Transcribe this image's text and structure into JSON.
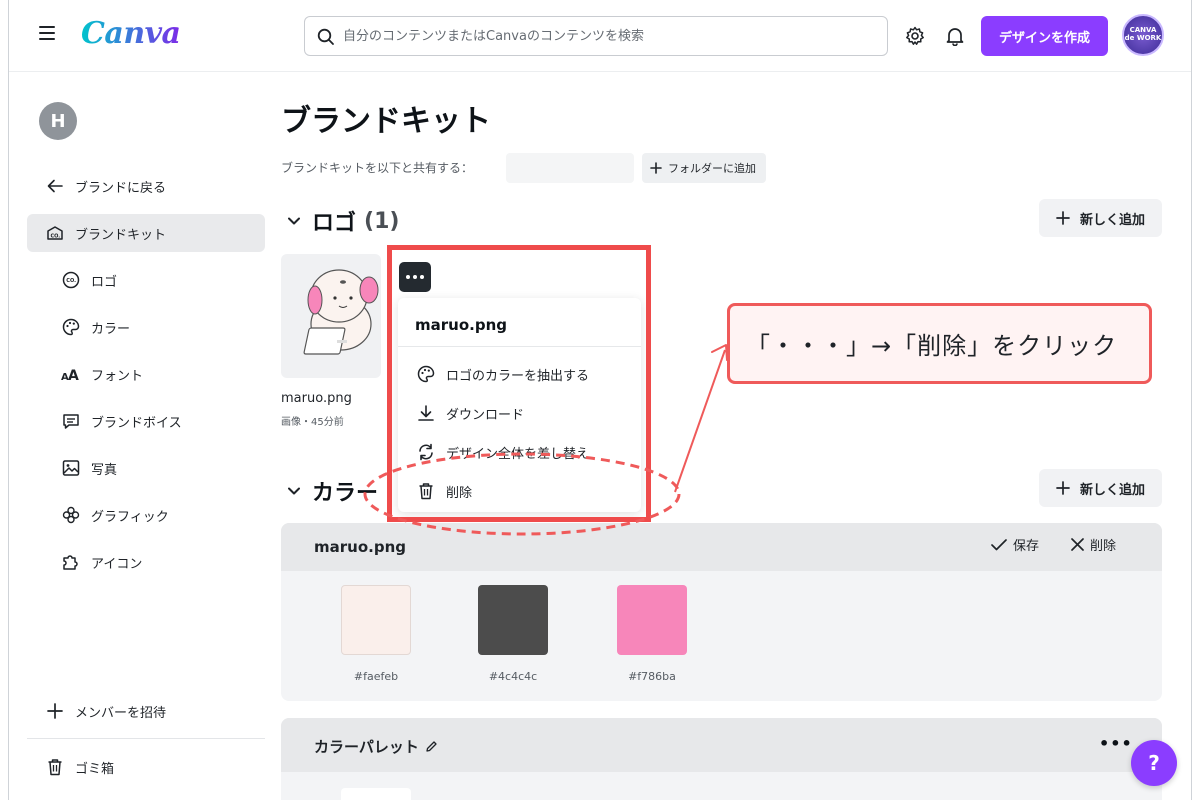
{
  "header": {
    "logo": "Canva",
    "search_placeholder": "自分のコンテンツまたはCanvaのコンテンツを検索",
    "create_label": "デザインを作成",
    "avatar_text": "CANVA de WORK"
  },
  "sidebar": {
    "user_initial": "H",
    "back_label": "ブランドに戻る",
    "items": [
      {
        "label": "ブランドキット",
        "icon": "brand-kit-icon",
        "active": true
      },
      {
        "label": "ロゴ",
        "icon": "logo-icon"
      },
      {
        "label": "カラー",
        "icon": "palette-icon"
      },
      {
        "label": "フォント",
        "icon": "font-icon"
      },
      {
        "label": "ブランドボイス",
        "icon": "message-icon"
      },
      {
        "label": "写真",
        "icon": "photo-icon"
      },
      {
        "label": "グラフィック",
        "icon": "graphic-icon"
      },
      {
        "label": "アイコン",
        "icon": "puzzle-icon"
      }
    ],
    "invite_label": "メンバーを招待",
    "trash_label": "ゴミ箱"
  },
  "main": {
    "title": "ブランドキット",
    "share_label": "ブランドキットを以下と共有する：",
    "folder_label": "フォルダーに追加",
    "logo_section": {
      "title": "ロゴ",
      "count": "(1)",
      "add_label": "新しく追加"
    },
    "logo_file": {
      "name": "maruo.png",
      "meta": "画像・45分前"
    },
    "color_section": {
      "title": "カラー",
      "add_label": "新しく追加"
    },
    "palette": {
      "name": "maruo.png",
      "save_label": "保存",
      "delete_label": "削除",
      "swatches": [
        {
          "hex": "#faefeb",
          "label": "#faefeb"
        },
        {
          "hex": "#4c4c4c",
          "label": "#4c4c4c"
        },
        {
          "hex": "#f786ba",
          "label": "#f786ba"
        }
      ]
    },
    "palette2": {
      "name": "カラーパレット",
      "more": "•••"
    }
  },
  "context_menu": {
    "title": "maruo.png",
    "items": [
      {
        "label": "ロゴのカラーを抽出する",
        "icon": "palette-icon"
      },
      {
        "label": "ダウンロード",
        "icon": "download-icon"
      },
      {
        "label": "デザイン全体を差し替え",
        "icon": "replace-icon"
      },
      {
        "label": "削除",
        "icon": "trash-icon"
      }
    ]
  },
  "annotation": {
    "callout": "「・・・」→「削除」をクリック"
  },
  "help_label": "?"
}
